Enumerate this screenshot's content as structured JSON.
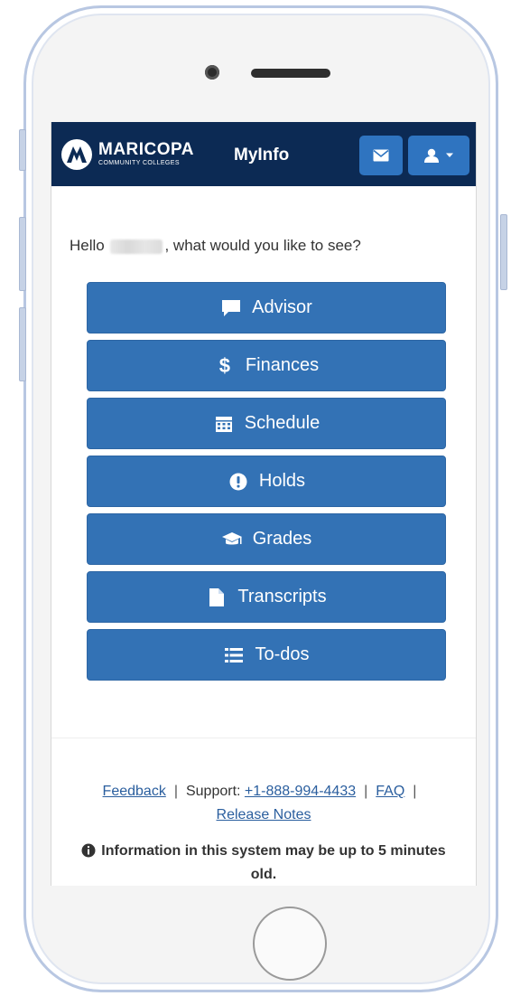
{
  "header": {
    "brand_name": "MARICOPA",
    "brand_sub": "COMMUNITY COLLEGES",
    "app_title": "MyInfo",
    "mail_icon": "envelope-icon",
    "user_icon": "user-icon"
  },
  "greeting": {
    "prefix": "Hello",
    "suffix": ", what would you like to see?"
  },
  "menu": [
    {
      "label": "Advisor",
      "icon": "comment-icon"
    },
    {
      "label": "Finances",
      "icon": "dollar-icon"
    },
    {
      "label": "Schedule",
      "icon": "calendar-icon"
    },
    {
      "label": "Holds",
      "icon": "exclamation-circle-icon"
    },
    {
      "label": "Grades",
      "icon": "graduation-cap-icon"
    },
    {
      "label": "Transcripts",
      "icon": "file-icon"
    },
    {
      "label": "To-dos",
      "icon": "list-icon"
    }
  ],
  "footer": {
    "feedback": "Feedback",
    "support_label": "Support:",
    "phone": "+1-888-994-4433",
    "faq": "FAQ",
    "release_notes": "Release Notes",
    "info_text": "Information in this system may be up to 5 minutes old."
  },
  "colors": {
    "header_bg": "#0c2a54",
    "button_bg": "#3372b5",
    "header_button_bg": "#2f74c0",
    "link": "#2a5e9e"
  }
}
